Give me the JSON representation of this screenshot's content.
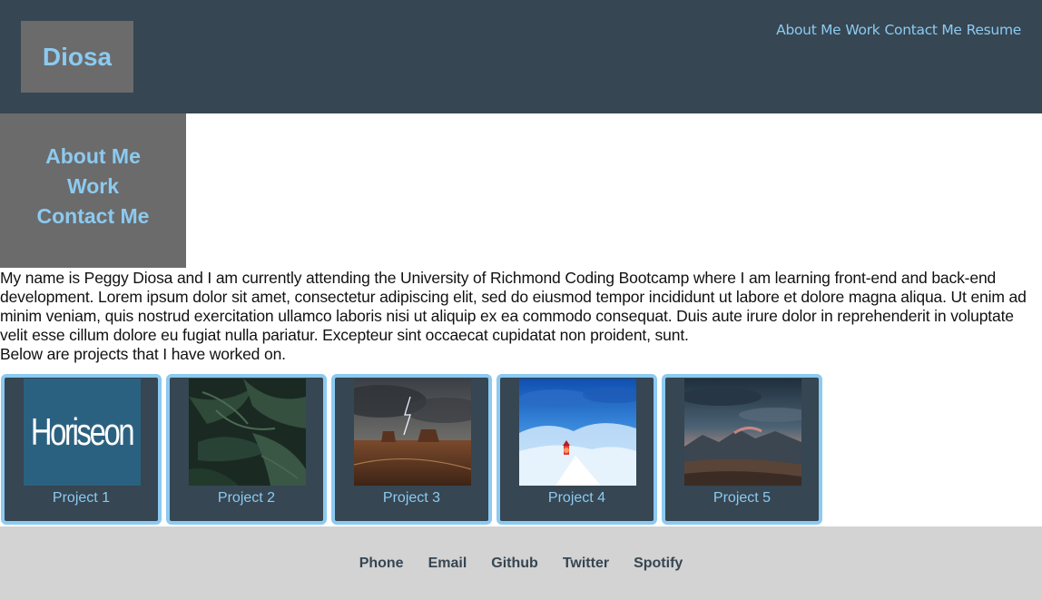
{
  "header": {
    "logo": "Diosa",
    "nav": [
      "About Me",
      "Work",
      "Contact Me",
      "Resume"
    ]
  },
  "sidebar": {
    "items": [
      "About Me",
      "Work",
      "Contact Me"
    ]
  },
  "intro": {
    "text": "My name is Peggy Diosa and I am currently attending the University of Richmond Coding Bootcamp where I am learning front-end and back-end development. Lorem ipsum dolor sit amet, consectetur adipiscing elit, sed do eiusmod tempor incididunt ut labore et dolore magna aliqua. Ut enim ad minim veniam, quis nostrud exercitation ullamco laboris nisi ut aliquip ex ea commodo consequat. Duis aute irure dolor in reprehenderit in voluptate velit esse cillum dolore eu fugiat nulla pariatur. Excepteur sint occaecat cupidatat non proident, sunt.",
    "projects_lead": "Below are projects that I have worked on."
  },
  "projects": [
    {
      "label": "Project 1",
      "thumb_text": "Horiseon"
    },
    {
      "label": "Project 2"
    },
    {
      "label": "Project 3"
    },
    {
      "label": "Project 4"
    },
    {
      "label": "Project 5"
    }
  ],
  "footer": {
    "links": [
      "Phone",
      "Email",
      "Github",
      "Twitter",
      "Spotify"
    ]
  },
  "colors": {
    "header_bg": "#364652",
    "accent": "#8ccaf0",
    "panel_gray": "#6b6b6b",
    "footer_bg": "#d3d3d3"
  }
}
